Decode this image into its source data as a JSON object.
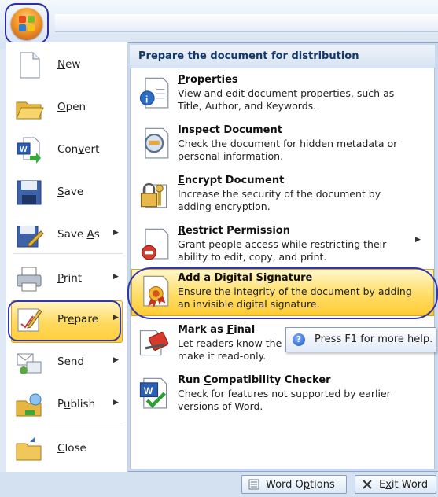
{
  "left_menu": {
    "items": [
      {
        "id": "new",
        "label": "New",
        "accel": 0,
        "icon": "new-document-icon",
        "arrow": false
      },
      {
        "id": "open",
        "label": "Open",
        "accel": 0,
        "icon": "open-folder-icon",
        "arrow": false
      },
      {
        "id": "convert",
        "label": "Convert",
        "accel": 3,
        "icon": "convert-document-icon",
        "arrow": false
      },
      {
        "id": "save",
        "label": "Save",
        "accel": 0,
        "icon": "save-icon",
        "arrow": false
      },
      {
        "id": "save-as",
        "label": "Save As",
        "accel": 5,
        "icon": "save-as-icon",
        "arrow": true
      },
      {
        "id": "print",
        "label": "Print",
        "accel": 0,
        "icon": "printer-icon",
        "arrow": true
      },
      {
        "id": "prepare",
        "label": "Prepare",
        "accel": 2,
        "icon": "prepare-icon",
        "arrow": true
      },
      {
        "id": "send",
        "label": "Send",
        "accel": 3,
        "icon": "send-icon",
        "arrow": true
      },
      {
        "id": "publish",
        "label": "Publish",
        "accel": 1,
        "icon": "publish-icon",
        "arrow": true
      },
      {
        "id": "close",
        "label": "Close",
        "accel": 0,
        "icon": "close-folder-icon",
        "arrow": false
      }
    ],
    "selected": "prepare"
  },
  "prepare_menu": {
    "header": "Prepare the document for distribution",
    "items": [
      {
        "id": "properties",
        "title": "Properties",
        "accel": 0,
        "desc": "View and edit document properties, such as Title, Author, and Keywords.",
        "icon": "properties-icon",
        "arrow": false
      },
      {
        "id": "inspect",
        "title": "Inspect Document",
        "accel": 0,
        "desc": "Check the document for hidden metadata or personal information.",
        "icon": "inspect-document-icon",
        "arrow": false
      },
      {
        "id": "encrypt",
        "title": "Encrypt Document",
        "accel": 0,
        "desc": "Increase the security of the document by adding encryption.",
        "icon": "encrypt-document-icon",
        "arrow": false
      },
      {
        "id": "restrict",
        "title": "Restrict Permission",
        "accel": 0,
        "desc": "Grant people access while restricting their ability to edit, copy, and print.",
        "icon": "restrict-permission-icon",
        "arrow": true
      },
      {
        "id": "signature",
        "title": "Add a Digital Signature",
        "accel": 14,
        "desc": "Ensure the integrity of the document by adding an invisible digital signature.",
        "icon": "digital-signature-icon",
        "arrow": false
      },
      {
        "id": "final",
        "title": "Mark as Final",
        "accel": 8,
        "desc": "Let readers know the document is final and make it read-only.",
        "icon": "mark-final-icon",
        "arrow": false
      },
      {
        "id": "compat",
        "title": "Run Compatibility Checker",
        "accel": 4,
        "desc": "Check for features not supported by earlier versions of Word.",
        "icon": "compatibility-checker-icon",
        "arrow": false
      }
    ],
    "highlighted": "signature"
  },
  "tooltip": {
    "text": "Press F1 for more help.",
    "icon": "help-icon"
  },
  "footer": {
    "options_label": "Word Options",
    "options_accel": 6,
    "exit_label": "Exit Word",
    "exit_accel": 1
  },
  "colors": {
    "highlight": "#ffd95c",
    "annotation_circle": "#3137a9",
    "header_text": "#15386b"
  }
}
